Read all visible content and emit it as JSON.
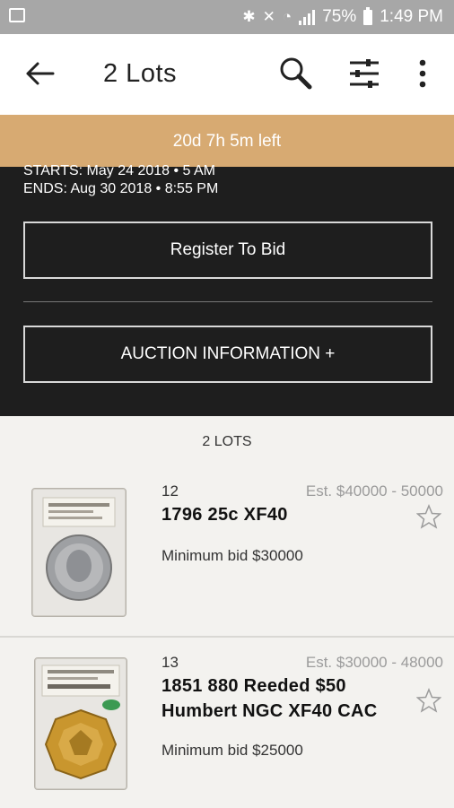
{
  "status_bar": {
    "battery": "75%",
    "time": "1:49 PM"
  },
  "app_bar": {
    "title": "2 Lots"
  },
  "banner": {
    "time_left": "20d 7h 5m  left"
  },
  "auction": {
    "starts": "STARTS: May 24 2018 • 5 AM",
    "ends": "ENDS: Aug 30 2018 • 8:55 PM",
    "register_label": "Register To Bid",
    "info_label": "AUCTION INFORMATION +"
  },
  "lots_count": "2 LOTS",
  "lots": [
    {
      "number": "12",
      "estimate": "Est. $40000 - 50000",
      "title": "1796 25c XF40",
      "min_bid": "Minimum bid $30000"
    },
    {
      "number": "13",
      "estimate": "Est. $30000 - 48000",
      "title": "1851 880 Reeded $50 Humbert NGC XF40 CAC",
      "min_bid": "Minimum bid $25000"
    }
  ],
  "colors": {
    "accent": "#d7aa72",
    "dark_panel": "#1e1e1e",
    "background": "#f3f2ef"
  },
  "icons": [
    "image-icon",
    "bluetooth-icon",
    "mute-icon",
    "wifi-icon",
    "signal-icon",
    "battery-icon",
    "back-arrow-icon",
    "search-icon",
    "filter-icon",
    "more-vert-icon",
    "star-icon"
  ]
}
